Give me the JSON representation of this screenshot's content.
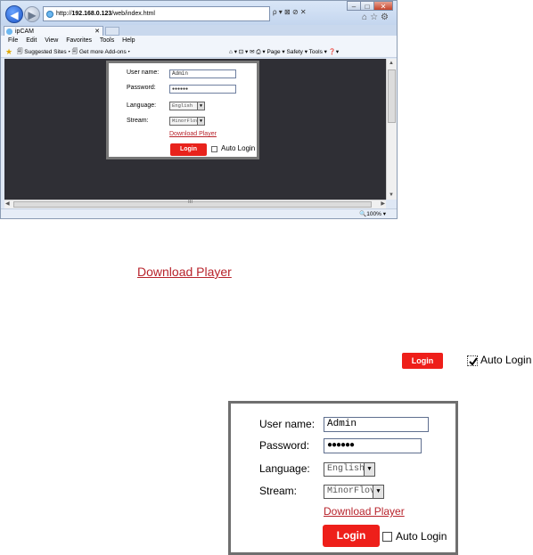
{
  "browser": {
    "address_prefix": "http://",
    "address_host": "192.168.0.123",
    "address_path": "/web/index.html",
    "address_tools": "ρ ▾ ⊠ ⊘ ✕",
    "tab_title": "ipCAM",
    "menu": [
      "File",
      "Edit",
      "View",
      "Favorites",
      "Tools",
      "Help"
    ],
    "favorites_left": "🗐 Suggested Sites ▾   🗐 Get more Add-ons ▾",
    "favorites_right": "⌂ ▾  ⊡ ▾  ✉  ⎙ ▾  Page ▾  Safety ▾  Tools ▾  ❓▾",
    "zoom": "🔍100%  ▾",
    "icons": {
      "back": "back-arrow-icon",
      "forward": "forward-arrow-icon",
      "home": "home-icon",
      "favorites": "star-icon",
      "settings": "gear-icon"
    }
  },
  "login_form": {
    "username_label": "User name:",
    "username_value": "Admin",
    "password_label": "Password:",
    "password_value": "●●●●●●",
    "language_label": "Language:",
    "language_value": "English",
    "stream_label": "Stream:",
    "stream_value": "MinorFlov",
    "download_link": "Download Player",
    "login_button": "Login",
    "auto_login_label": "Auto Login"
  },
  "annotations": {
    "download_player": "Download Player",
    "login_button": "Login",
    "auto_login_label": "Auto Login",
    "auto_login_checked": true
  },
  "colors": {
    "login_red": "#ee1f1a",
    "link_red": "#b8242c",
    "viewport_dark": "#2f2f35"
  }
}
